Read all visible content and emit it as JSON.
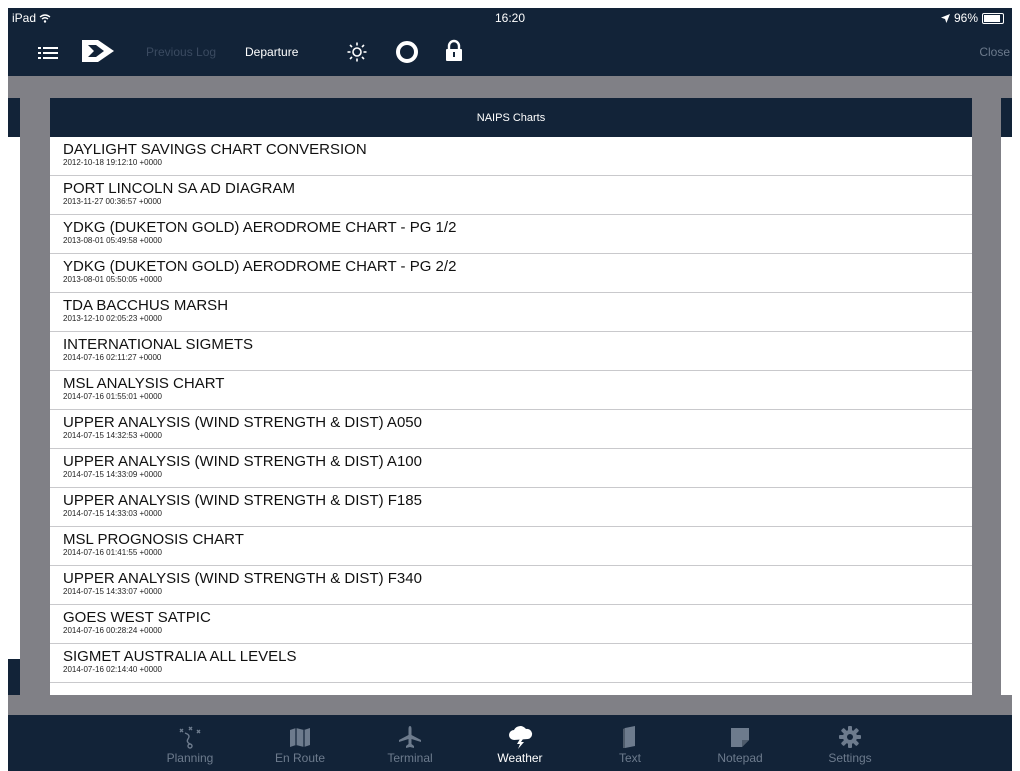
{
  "status": {
    "device": "iPad",
    "time": "16:20",
    "battery": "96%"
  },
  "nav": {
    "previous_log": "Previous Log",
    "departure": "Departure",
    "close": "Close"
  },
  "panel": {
    "title": "NAIPS Charts",
    "items": [
      {
        "title": "DAYLIGHT SAVINGS CHART CONVERSION",
        "date": "2012-10-18 19:12:10 +0000"
      },
      {
        "title": "PORT LINCOLN SA AD DIAGRAM",
        "date": "2013-11-27 00:36:57 +0000"
      },
      {
        "title": "YDKG (DUKETON GOLD) AERODROME CHART - PG 1/2",
        "date": "2013-08-01 05:49:58 +0000"
      },
      {
        "title": "YDKG (DUKETON GOLD) AERODROME CHART - PG 2/2",
        "date": "2013-08-01 05:50:05 +0000"
      },
      {
        "title": "TDA BACCHUS MARSH",
        "date": "2013-12-10 02:05:23 +0000"
      },
      {
        "title": "INTERNATIONAL SIGMETS",
        "date": "2014-07-16 02:11:27 +0000"
      },
      {
        "title": "MSL ANALYSIS CHART",
        "date": "2014-07-16 01:55:01 +0000"
      },
      {
        "title": "UPPER ANALYSIS (WIND STRENGTH & DIST) A050",
        "date": "2014-07-15 14:32:53 +0000"
      },
      {
        "title": "UPPER ANALYSIS (WIND STRENGTH & DIST) A100",
        "date": "2014-07-15 14:33:09 +0000"
      },
      {
        "title": "UPPER ANALYSIS (WIND STRENGTH & DIST) F185",
        "date": "2014-07-15 14:33:03 +0000"
      },
      {
        "title": "MSL PROGNOSIS CHART",
        "date": "2014-07-16 01:41:55 +0000"
      },
      {
        "title": "UPPER ANALYSIS (WIND STRENGTH & DIST) F340",
        "date": "2014-07-15 14:33:07 +0000"
      },
      {
        "title": "GOES WEST SATPIC",
        "date": "2014-07-16 00:28:24 +0000"
      },
      {
        "title": "SIGMET AUSTRALIA ALL LEVELS",
        "date": "2014-07-16 02:14:40 +0000"
      }
    ]
  },
  "tabs": [
    {
      "label": "Planning",
      "icon": "route-icon"
    },
    {
      "label": "En Route",
      "icon": "map-icon"
    },
    {
      "label": "Terminal",
      "icon": "airplane-icon"
    },
    {
      "label": "Weather",
      "icon": "weather-icon",
      "active": true
    },
    {
      "label": "Text",
      "icon": "book-icon"
    },
    {
      "label": "Notepad",
      "icon": "notepad-icon"
    },
    {
      "label": "Settings",
      "icon": "gear-icon"
    }
  ],
  "colors": {
    "bar": "#122338",
    "background": "#808086",
    "inactive_tab": "#6d7b8d"
  }
}
